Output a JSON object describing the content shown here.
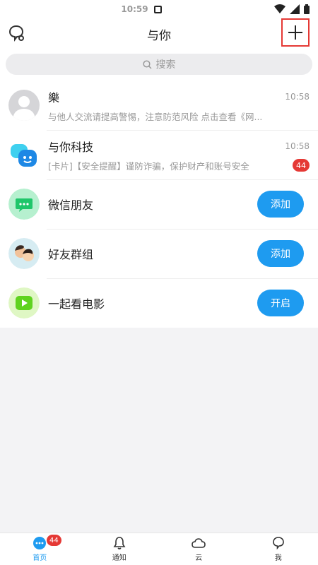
{
  "status_bar": {
    "time": "10:59"
  },
  "header": {
    "title": "与你"
  },
  "search": {
    "placeholder": "搜索"
  },
  "conversations": [
    {
      "name": "樂",
      "time": "10:58",
      "preview": "与他人交流请提高警惕，注意防范风险 点击查看《网..."
    },
    {
      "name": "与你科技",
      "time": "10:58",
      "preview": "[卡片]【安全提醒】谨防诈骗，保护财产和账号安全",
      "badge": "44"
    }
  ],
  "apps": [
    {
      "label": "微信朋友",
      "button": "添加"
    },
    {
      "label": "好友群组",
      "button": "添加"
    },
    {
      "label": "一起看电影",
      "button": "开启"
    }
  ],
  "tabbar": {
    "items": [
      {
        "label": "首页",
        "badge": "44"
      },
      {
        "label": "通知"
      },
      {
        "label": "云"
      },
      {
        "label": "我"
      }
    ]
  },
  "colors": {
    "accent": "#1e9bf0",
    "badge": "#e53935",
    "highlight": "#e53935"
  }
}
